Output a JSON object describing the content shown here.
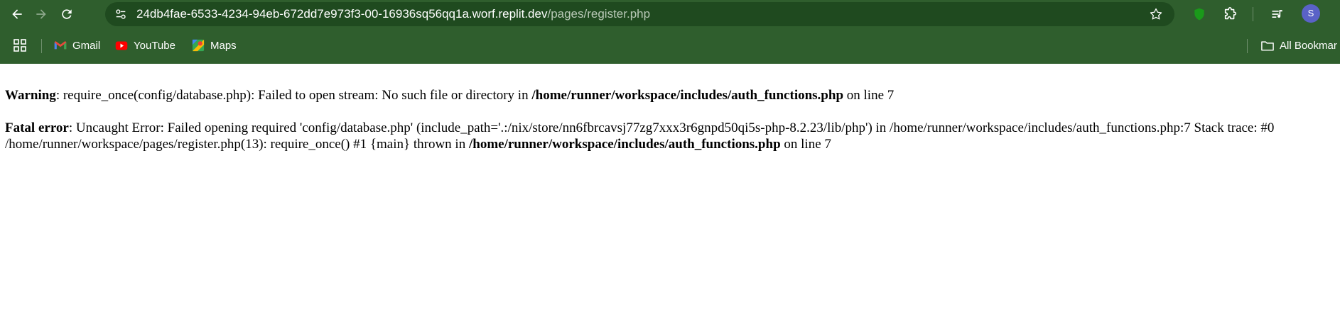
{
  "browser": {
    "url_host": "24db4fae-6533-4234-94eb-672dd7e973f3-00-16936sq56qq1a.worf.replit.dev",
    "url_path": "/pages/register.php",
    "avatar_letter": "S",
    "colors": {
      "chrome": "#2f5e2d",
      "omnibox": "#1f4a1f",
      "avatar": "#5a62c7"
    },
    "icons": [
      "back-icon",
      "forward-icon",
      "reload-icon",
      "site-info-icon",
      "star-icon",
      "extension-shield-icon",
      "puzzle-icon",
      "media-icon"
    ]
  },
  "bookmarks": {
    "items": [
      {
        "label": "Gmail",
        "icon": "gmail-icon"
      },
      {
        "label": "YouTube",
        "icon": "youtube-icon"
      },
      {
        "label": "Maps",
        "icon": "maps-icon"
      }
    ],
    "all_bookmarks_label": "All Bookmar"
  },
  "page": {
    "warning": {
      "label": "Warning",
      "text": ": require_once(config/database.php): Failed to open stream: No such file or directory in ",
      "file": "/home/runner/workspace/includes/auth_functions.php",
      "line_text": " on line 7"
    },
    "fatal": {
      "label": "Fatal error",
      "text_line1": ": Uncaught Error: Failed opening required 'config/database.php' (include_path='.:/nix/store/nn6fbrcavsj77zg7xxx3r6gnpd50qi5s-php-8.2.23/lib/php') in /home/runner/workspace/includes/auth_functions.php:7 Stack trace: #0",
      "text_line2": "/home/runner/workspace/pages/register.php(13): require_once() #1 {main} thrown in ",
      "file": "/home/runner/workspace/includes/auth_functions.php",
      "line_text": " on line 7"
    }
  }
}
